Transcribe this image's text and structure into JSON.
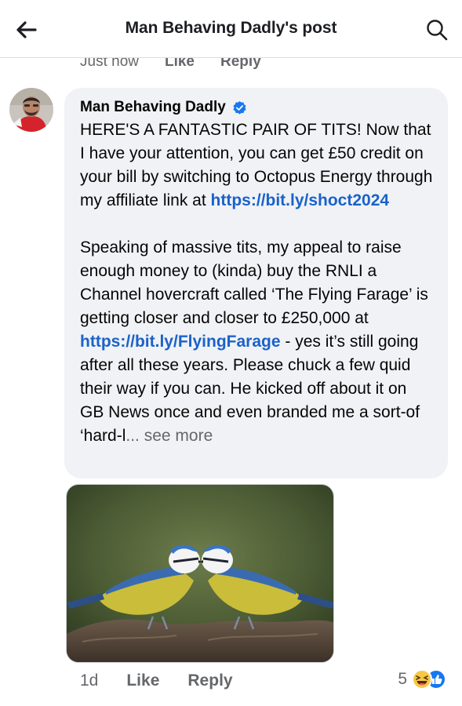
{
  "header": {
    "title": "Man Behaving Dadly's post",
    "back_icon": "back-arrow-icon",
    "search_icon": "search-icon"
  },
  "previous_comment": {
    "time": "Just now",
    "like": "Like",
    "reply": "Reply"
  },
  "comment": {
    "author": "Man Behaving Dadly",
    "verified_color": "#1877f2",
    "para1_text": "HERE'S A FANTASTIC PAIR OF TITS! Now that I have your attention, you can get £50 credit on your bill by switching to Octopus Energy through my affiliate link at ",
    "para1_link": "https://bit.ly/shoct2024",
    "para2_text_a": "Speaking of massive tits, my appeal to raise enough money to (kinda) buy the RNLI a Channel hovercraft called ‘The Flying Farage’ is getting closer and closer to £250,000 at ",
    "para2_link": "https://bit.ly/FlyingFarage",
    "para2_text_b": " - yes it’s still going after all these years. Please chuck a few quid their way if you can. He kicked off about it on GB News once and even branded me a sort-of ‘hard-l",
    "ellipsis": "...",
    "see_more": " see more",
    "time": "1d",
    "like": "Like",
    "reply": "Reply",
    "reaction_count": "5",
    "reaction_icons": [
      "haha-emoji-icon",
      "like-thumb-icon"
    ]
  },
  "colors": {
    "link": "#1a62c9",
    "bubble": "#f0f2f5",
    "muted": "#65676b"
  }
}
